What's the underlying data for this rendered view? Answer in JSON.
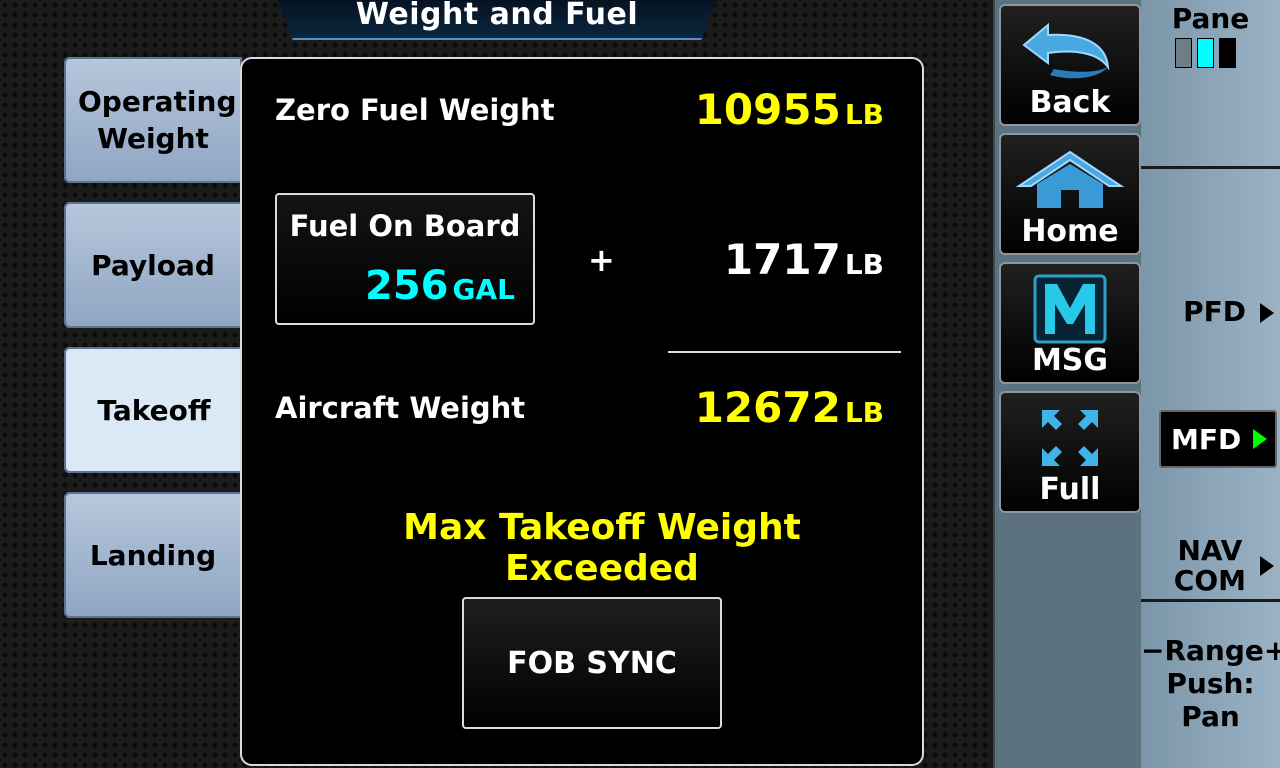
{
  "title": "Weight and Fuel",
  "tabs": [
    {
      "label": "Operating Weight",
      "active": false
    },
    {
      "label": "Payload",
      "active": false
    },
    {
      "label": "Takeoff",
      "active": true
    },
    {
      "label": "Landing",
      "active": false
    }
  ],
  "zero_fuel": {
    "label": "Zero Fuel Weight",
    "value": "10955",
    "unit": "LB"
  },
  "fuel_on_board": {
    "label": "Fuel On Board",
    "value": "256",
    "unit": "GAL"
  },
  "plus": "+",
  "fuel_weight": {
    "value": "1717",
    "unit": "LB"
  },
  "aircraft_weight": {
    "label": "Aircraft Weight",
    "value": "12672",
    "unit": "LB"
  },
  "warning": "Max Takeoff Weight Exceeded",
  "fob_sync_label": "FOB SYNC",
  "nav_buttons": {
    "back": "Back",
    "home": "Home",
    "msg": "MSG",
    "full": "Full"
  },
  "softkeys": {
    "pane": "Pane",
    "pfd": "PFD",
    "mfd": "MFD",
    "nav_com_1": "NAV",
    "nav_com_2": "COM",
    "range": "−Range+",
    "push": "Push:",
    "pan": "Pan"
  },
  "colors": {
    "value_yellow": "#ffff00",
    "value_cyan": "#00ffff",
    "active_indicator": "#00ff00"
  }
}
